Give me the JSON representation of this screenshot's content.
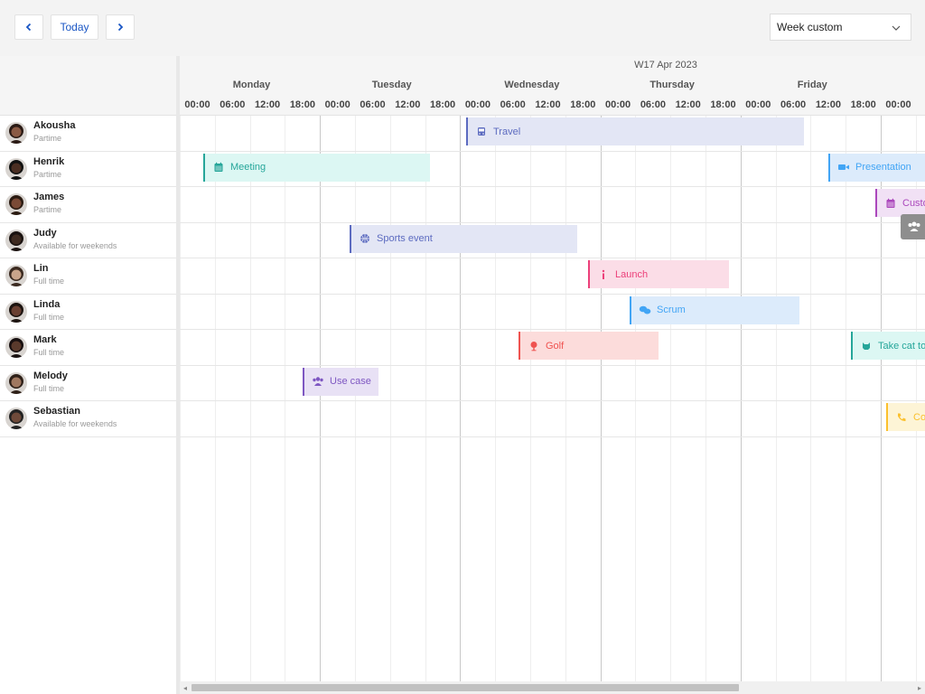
{
  "toolbar": {
    "prev_icon": "chevron-left-icon",
    "today_label": "Today",
    "next_icon": "chevron-right-icon",
    "view_select_value": "Week custom"
  },
  "timeline": {
    "week_label": "W17 Apr 2023",
    "days": [
      "Monday",
      "Tuesday",
      "Wednesday",
      "Thursday",
      "Friday"
    ],
    "hours": [
      "00:00",
      "06:00",
      "12:00",
      "18:00",
      "00:00",
      "06:00",
      "12:00",
      "18:00",
      "00:00",
      "06:00",
      "12:00",
      "18:00",
      "00:00",
      "06:00",
      "12:00",
      "18:00",
      "00:00",
      "06:00",
      "12:00",
      "18:00",
      "00:00"
    ]
  },
  "resources": [
    {
      "name": "Akousha",
      "subtitle": "Partime"
    },
    {
      "name": "Henrik",
      "subtitle": "Partime"
    },
    {
      "name": "James",
      "subtitle": "Partime"
    },
    {
      "name": "Judy",
      "subtitle": "Available for weekends"
    },
    {
      "name": "Lin",
      "subtitle": "Full time"
    },
    {
      "name": "Linda",
      "subtitle": "Full time"
    },
    {
      "name": "Mark",
      "subtitle": "Full time"
    },
    {
      "name": "Melody",
      "subtitle": "Full time"
    },
    {
      "name": "Sebastian",
      "subtitle": "Available for weekends"
    }
  ],
  "events": [
    {
      "resource": 0,
      "title": "Travel",
      "icon": "bus-icon",
      "color": "#5c6bc0",
      "bg": "#e3e6f5"
    },
    {
      "resource": 1,
      "title": "Meeting",
      "icon": "calendar-icon",
      "color": "#26a69a",
      "bg": "#dcf7f3"
    },
    {
      "resource": 1,
      "title": "Presentation",
      "icon": "video-icon",
      "color": "#42a5f5",
      "bg": "#dcebfb"
    },
    {
      "resource": 2,
      "title": "Custo",
      "icon": "calendar-icon",
      "color": "#ab47bc",
      "bg": "#f1e1f5"
    },
    {
      "resource": 3,
      "title": "Sports event",
      "icon": "basketball-icon",
      "color": "#5c6bc0",
      "bg": "#e3e6f5"
    },
    {
      "resource": 4,
      "title": "Launch",
      "icon": "info-icon",
      "color": "#ec407a",
      "bg": "#fbdde7"
    },
    {
      "resource": 5,
      "title": "Scrum",
      "icon": "comments-icon",
      "color": "#42a5f5",
      "bg": "#dcebfb"
    },
    {
      "resource": 6,
      "title": "Golf",
      "icon": "golf-icon",
      "color": "#ef5350",
      "bg": "#fcdcdb"
    },
    {
      "resource": 6,
      "title": "Take cat to",
      "icon": "cat-icon",
      "color": "#26a69a",
      "bg": "#dcf7f3"
    },
    {
      "resource": 7,
      "title": "Use case",
      "icon": "users-icon",
      "color": "#7e57c2",
      "bg": "#e8e1f5"
    },
    {
      "resource": 8,
      "title": "Co",
      "icon": "phone-icon",
      "color": "#fbc02d",
      "bg": "#fdf4d6"
    }
  ],
  "tooltip_icon": "users-icon"
}
